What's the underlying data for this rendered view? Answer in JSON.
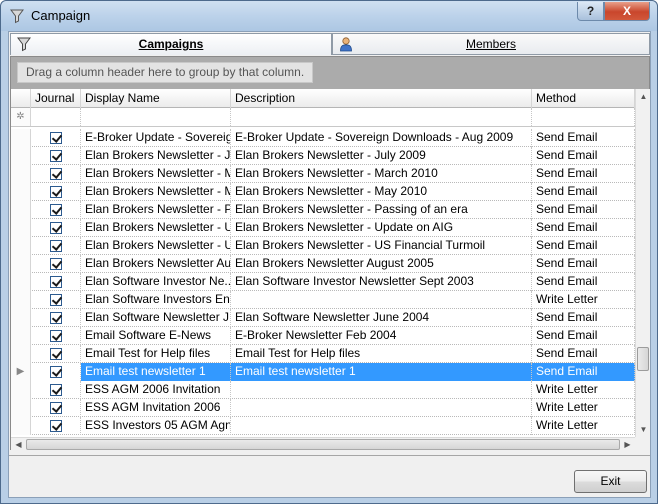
{
  "window": {
    "title": "Campaign",
    "help_label": "?",
    "close_label": "X"
  },
  "tabs": [
    {
      "label": "Campaigns",
      "icon": "filter-funnel-icon"
    },
    {
      "label": "Members",
      "icon": "person-icon"
    }
  ],
  "group_panel": {
    "hint": "Drag a column header here to group by that column."
  },
  "columns": [
    "Journal",
    "Display Name",
    "Description",
    "Method"
  ],
  "new_row_marker": "✲",
  "rows": [
    {
      "journal": true,
      "name": "E-Broker Update - Sovereig...",
      "description": "E-Broker Update - Sovereign Downloads - Aug 2009",
      "method": "Send Email"
    },
    {
      "journal": true,
      "name": "Elan Brokers Newsletter - J...",
      "description": "Elan Brokers Newsletter - July 2009",
      "method": "Send Email"
    },
    {
      "journal": true,
      "name": "Elan Brokers Newsletter - M...",
      "description": "Elan Brokers Newsletter - March 2010",
      "method": "Send Email"
    },
    {
      "journal": true,
      "name": "Elan Brokers Newsletter - M...",
      "description": "Elan Brokers Newsletter - May 2010",
      "method": "Send Email"
    },
    {
      "journal": true,
      "name": "Elan Brokers Newsletter - P...",
      "description": "Elan Brokers Newsletter - Passing of an era",
      "method": "Send Email"
    },
    {
      "journal": true,
      "name": "Elan Brokers Newsletter - U...",
      "description": "Elan Brokers Newsletter - Update on AIG",
      "method": "Send Email"
    },
    {
      "journal": true,
      "name": "Elan Brokers Newsletter - U...",
      "description": "Elan Brokers Newsletter - US Financial Turmoil",
      "method": "Send Email"
    },
    {
      "journal": true,
      "name": "Elan Brokers Newsletter Au...",
      "description": "Elan Brokers Newsletter August 2005",
      "method": "Send Email"
    },
    {
      "journal": true,
      "name": "Elan Software Investor Ne...",
      "description": "Elan Software Investor Newsletter Sept 2003",
      "method": "Send Email"
    },
    {
      "journal": true,
      "name": "Elan Software Investors En...",
      "description": "",
      "method": "Write Letter"
    },
    {
      "journal": true,
      "name": "Elan Software Newsletter J...",
      "description": "Elan Software Newsletter June 2004",
      "method": "Send Email"
    },
    {
      "journal": true,
      "name": "Email Software E-News",
      "description": "E-Broker Newsletter Feb 2004",
      "method": "Send Email"
    },
    {
      "journal": true,
      "name": "Email Test for Help files",
      "description": "Email Test for Help files",
      "method": "Send Email"
    },
    {
      "journal": true,
      "name": "Email test newsletter 1",
      "description": "Email test newsletter 1",
      "method": "Send Email",
      "selected": true
    },
    {
      "journal": true,
      "name": "ESS AGM 2006 Invitation",
      "description": "",
      "method": "Write Letter"
    },
    {
      "journal": true,
      "name": "ESS AGM Invitation 2006",
      "description": "",
      "method": "Write Letter"
    },
    {
      "journal": true,
      "name": "ESS Investors 05 AGM Agn...",
      "description": "",
      "method": "Write Letter"
    }
  ],
  "selected_row_indicator": "▶",
  "scroll": {
    "up": "▲",
    "down": "▼",
    "left": "◀",
    "right": "▶"
  },
  "buttons": {
    "exit": "Exit"
  }
}
